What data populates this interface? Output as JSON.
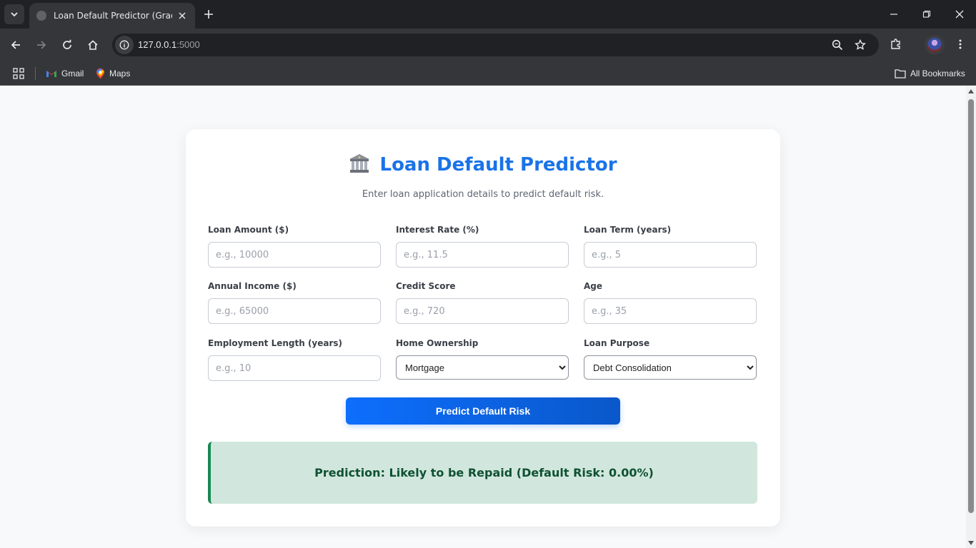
{
  "browser": {
    "tab_title": "Loan Default Predictor (Gradient",
    "url_host": "127.0.0.1",
    "url_port": ":5000",
    "bookmarks": [
      {
        "label": "Gmail",
        "icon": "gmail-icon"
      },
      {
        "label": "Maps",
        "icon": "maps-icon"
      }
    ],
    "all_bookmarks_label": "All Bookmarks"
  },
  "page": {
    "title": "Loan Default Predictor",
    "title_icon": "bank-icon",
    "subtitle": "Enter loan application details to predict default risk.",
    "fields": [
      {
        "label": "Loan Amount ($)",
        "placeholder": "e.g., 10000",
        "type": "input"
      },
      {
        "label": "Interest Rate (%)",
        "placeholder": "e.g., 11.5",
        "type": "input"
      },
      {
        "label": "Loan Term (years)",
        "placeholder": "e.g., 5",
        "type": "input"
      },
      {
        "label": "Annual Income ($)",
        "placeholder": "e.g., 65000",
        "type": "input"
      },
      {
        "label": "Credit Score",
        "placeholder": "e.g., 720",
        "type": "input"
      },
      {
        "label": "Age",
        "placeholder": "e.g., 35",
        "type": "input"
      },
      {
        "label": "Employment Length (years)",
        "placeholder": "e.g., 10",
        "type": "input"
      },
      {
        "label": "Home Ownership",
        "selected": "Mortgage",
        "type": "select"
      },
      {
        "label": "Loan Purpose",
        "selected": "Debt Consolidation",
        "type": "select"
      }
    ],
    "submit_label": "Predict Default Risk",
    "result_text": "Prediction: Likely to be Repaid (Default Risk: 0.00%)"
  },
  "colors": {
    "accent": "#1a73e8",
    "button": "#0d6efd",
    "success_bg": "#d1e7dd",
    "success_border": "#198754",
    "success_text": "#0f5132"
  }
}
